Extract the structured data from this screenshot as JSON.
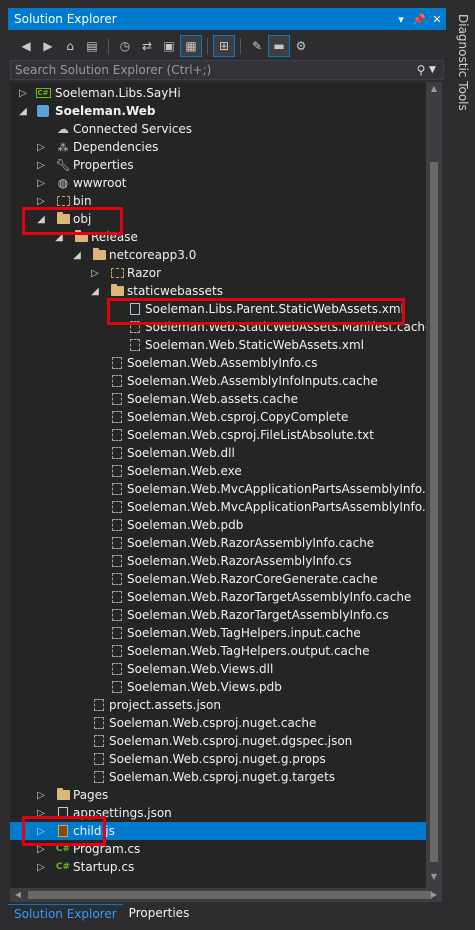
{
  "window": {
    "title": "Solution Explorer",
    "buttons": [
      "▾",
      "📌",
      "✕"
    ]
  },
  "side_tab": "Diagnostic Tools",
  "search": {
    "placeholder": "Search Solution Explorer (Ctrl+;)"
  },
  "toolbar": {
    "icons": [
      "back-icon",
      "forward-icon",
      "home-icon",
      "switch-views-icon",
      "history-icon",
      "sync-icon",
      "collapse-icon",
      "show-all-files-icon",
      "pending-changes-icon",
      "properties-icon",
      "preview-icon",
      "view-class-diagram-icon"
    ]
  },
  "tree": [
    {
      "label": "Soeleman.Libs.SayHi",
      "level": 0,
      "expander": "▷",
      "icon": "csproj-icon"
    },
    {
      "label": "Soeleman.Web",
      "level": 0,
      "expander": "◢",
      "icon": "web-project-icon",
      "bold": true
    },
    {
      "label": "Connected Services",
      "level": 1,
      "expander": "",
      "icon": "connected-services-icon"
    },
    {
      "label": "Dependencies",
      "level": 1,
      "expander": "▷",
      "icon": "dependencies-icon"
    },
    {
      "label": "Properties",
      "level": 1,
      "expander": "▷",
      "icon": "wrench-icon"
    },
    {
      "label": "wwwroot",
      "level": 1,
      "expander": "▷",
      "icon": "globe-icon"
    },
    {
      "label": "bin",
      "level": 1,
      "expander": "▷",
      "icon": "folder-dotted-icon"
    },
    {
      "label": "obj",
      "level": 1,
      "expander": "◢",
      "icon": "folder-icon"
    },
    {
      "label": "Release",
      "level": 2,
      "expander": "◢",
      "icon": "folder-icon"
    },
    {
      "label": "netcoreapp3.0",
      "level": 3,
      "expander": "◢",
      "icon": "folder-icon"
    },
    {
      "label": "Razor",
      "level": 4,
      "expander": "▷",
      "icon": "folder-dotted-icon"
    },
    {
      "label": "staticwebassets",
      "level": 4,
      "expander": "◢",
      "icon": "folder-icon"
    },
    {
      "label": "Soeleman.Libs.Parent.StaticWebAssets.xml",
      "level": 5,
      "expander": "",
      "icon": "xml-file-icon"
    },
    {
      "label": "Soeleman.Web.StaticWebAssets.Manifest.cache",
      "level": 5,
      "expander": "",
      "icon": "file-icon"
    },
    {
      "label": "Soeleman.Web.StaticWebAssets.xml",
      "level": 5,
      "expander": "",
      "icon": "file-icon"
    },
    {
      "label": "Soeleman.Web.AssemblyInfo.cs",
      "level": 4,
      "expander": "",
      "icon": "file-icon"
    },
    {
      "label": "Soeleman.Web.AssemblyInfoInputs.cache",
      "level": 4,
      "expander": "",
      "icon": "file-icon"
    },
    {
      "label": "Soeleman.Web.assets.cache",
      "level": 4,
      "expander": "",
      "icon": "file-icon"
    },
    {
      "label": "Soeleman.Web.csproj.CopyComplete",
      "level": 4,
      "expander": "",
      "icon": "file-icon"
    },
    {
      "label": "Soeleman.Web.csproj.FileListAbsolute.txt",
      "level": 4,
      "expander": "",
      "icon": "file-icon"
    },
    {
      "label": "Soeleman.Web.dll",
      "level": 4,
      "expander": "",
      "icon": "file-icon"
    },
    {
      "label": "Soeleman.Web.exe",
      "level": 4,
      "expander": "",
      "icon": "file-icon"
    },
    {
      "label": "Soeleman.Web.MvcApplicationPartsAssemblyInfo.cach",
      "level": 4,
      "expander": "",
      "icon": "file-icon"
    },
    {
      "label": "Soeleman.Web.MvcApplicationPartsAssemblyInfo.cs",
      "level": 4,
      "expander": "",
      "icon": "file-icon"
    },
    {
      "label": "Soeleman.Web.pdb",
      "level": 4,
      "expander": "",
      "icon": "file-icon"
    },
    {
      "label": "Soeleman.Web.RazorAssemblyInfo.cache",
      "level": 4,
      "expander": "",
      "icon": "file-icon"
    },
    {
      "label": "Soeleman.Web.RazorAssemblyInfo.cs",
      "level": 4,
      "expander": "",
      "icon": "file-icon"
    },
    {
      "label": "Soeleman.Web.RazorCoreGenerate.cache",
      "level": 4,
      "expander": "",
      "icon": "file-icon"
    },
    {
      "label": "Soeleman.Web.RazorTargetAssemblyInfo.cache",
      "level": 4,
      "expander": "",
      "icon": "file-icon"
    },
    {
      "label": "Soeleman.Web.RazorTargetAssemblyInfo.cs",
      "level": 4,
      "expander": "",
      "icon": "file-icon"
    },
    {
      "label": "Soeleman.Web.TagHelpers.input.cache",
      "level": 4,
      "expander": "",
      "icon": "file-icon"
    },
    {
      "label": "Soeleman.Web.TagHelpers.output.cache",
      "level": 4,
      "expander": "",
      "icon": "file-icon"
    },
    {
      "label": "Soeleman.Web.Views.dll",
      "level": 4,
      "expander": "",
      "icon": "file-icon"
    },
    {
      "label": "Soeleman.Web.Views.pdb",
      "level": 4,
      "expander": "",
      "icon": "file-icon"
    },
    {
      "label": "project.assets.json",
      "level": 3,
      "expander": "",
      "icon": "file-icon"
    },
    {
      "label": "Soeleman.Web.csproj.nuget.cache",
      "level": 3,
      "expander": "",
      "icon": "file-icon"
    },
    {
      "label": "Soeleman.Web.csproj.nuget.dgspec.json",
      "level": 3,
      "expander": "",
      "icon": "file-icon"
    },
    {
      "label": "Soeleman.Web.csproj.nuget.g.props",
      "level": 3,
      "expander": "",
      "icon": "file-icon"
    },
    {
      "label": "Soeleman.Web.csproj.nuget.g.targets",
      "level": 3,
      "expander": "",
      "icon": "file-icon"
    },
    {
      "label": "Pages",
      "level": 1,
      "expander": "▷",
      "icon": "folder-icon"
    },
    {
      "label": "appsettings.json",
      "level": 1,
      "expander": "▷",
      "icon": "json-file-icon"
    },
    {
      "label": "child.js",
      "level": 1,
      "expander": "▷",
      "icon": "js-file-icon",
      "selected": true
    },
    {
      "label": "Program.cs",
      "level": 1,
      "expander": "▷",
      "icon": "cs-file-icon"
    },
    {
      "label": "Startup.cs",
      "level": 1,
      "expander": "▷",
      "icon": "cs-file-icon"
    }
  ],
  "bottom_tabs": [
    "Solution Explorer",
    "Properties"
  ],
  "colors": {
    "accent": "#007acc",
    "selection": "#007acc",
    "highlight_box": "#e3000f"
  }
}
